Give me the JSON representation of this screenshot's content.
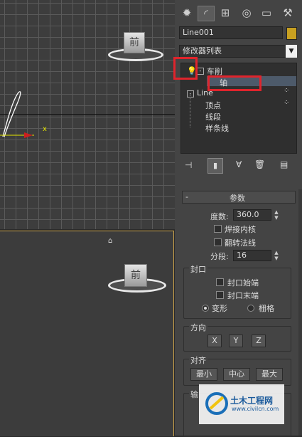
{
  "viewport_top": {
    "cube_label": "前",
    "axis_label": "x"
  },
  "viewport_persp": {
    "cube_label": "前"
  },
  "command_panel": {
    "tabs": [
      "create-icon",
      "modify-icon",
      "hierarchy-icon",
      "motion-icon",
      "display-icon",
      "utilities-icon"
    ],
    "object_name": "Line001",
    "object_color": "#c8a020",
    "modifier_list": "修改器列表",
    "stack": [
      {
        "label": "车削",
        "level": 0
      },
      {
        "label": "轴",
        "level": 1,
        "selected": true
      },
      {
        "label": "Line",
        "level": 0
      },
      {
        "label": "顶点",
        "level": 1
      },
      {
        "label": "线段",
        "level": 1
      },
      {
        "label": "样条线",
        "level": 1
      }
    ]
  },
  "params": {
    "header": "参数",
    "collapse": "-",
    "degrees_label": "度数:",
    "degrees_value": "360.0",
    "weld_core": "焊接内核",
    "flip_normals": "翻转法线",
    "segments_label": "分段:",
    "segments_value": "16",
    "capping": {
      "title": "封口",
      "cap_start": "封口始端",
      "cap_end": "封口末端",
      "morph": "变形",
      "grid": "栅格"
    },
    "direction": {
      "title": "方向",
      "x": "X",
      "y": "Y",
      "z": "Z"
    },
    "align": {
      "title": "对齐",
      "min": "最小",
      "center": "中心",
      "max": "最大"
    },
    "output_title": "输"
  },
  "watermark": {
    "name": "土木工程网",
    "url": "www.civilcn.com"
  }
}
